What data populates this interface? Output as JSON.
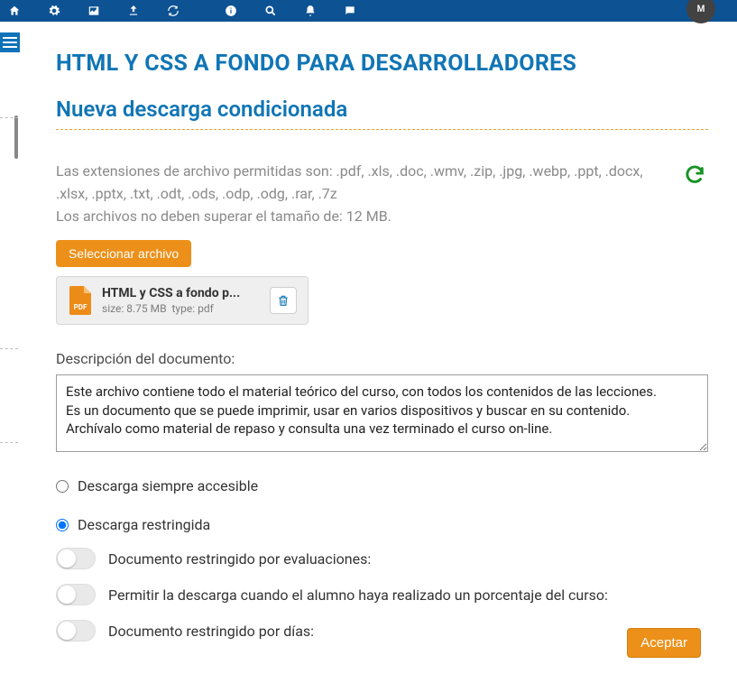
{
  "topbar": {
    "avatar_initials": "M"
  },
  "page": {
    "title": "HTML Y CSS A FONDO PARA DESARROLLADORES",
    "section": "Nueva descarga condicionada"
  },
  "help": {
    "line1": "Las extensiones de archivo permitidas son: .pdf, .xls, .doc, .wmv, .zip, .jpg, .webp, .ppt, .docx, .xlsx, .pptx, .txt, .odt, .ods, .odp, .odg, .rar, .7z",
    "line2": "Los archivos no deben superar el tamaño de: 12 MB."
  },
  "buttons": {
    "select_file": "Seleccionar archivo",
    "accept": "Aceptar"
  },
  "file": {
    "name": "HTML y CSS a fondo p...",
    "size": "size: 8.75 MB",
    "type": "type: pdf"
  },
  "description": {
    "label": "Descripción del documento:",
    "value": "Este archivo contiene todo el material teórico del curso, con todos los contenidos de las lecciones.\nEs un documento que se puede imprimir, usar en varios dispositivos y buscar en su contenido.\nArchívalo como material de repaso y consulta una vez terminado el curso on-line."
  },
  "access": {
    "always": "Descarga siempre accesible",
    "restricted": "Descarga restringida",
    "selected": "restricted"
  },
  "toggles": {
    "by_evals": "Documento restringido por evaluaciones:",
    "by_percent": "Permitir la descarga cuando el alumno haya realizado un porcentaje del curso:",
    "by_days": "Documento restringido por días:"
  }
}
